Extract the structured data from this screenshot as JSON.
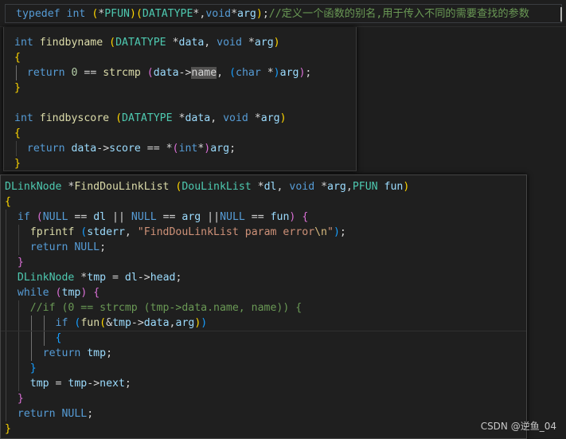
{
  "editor": {
    "top_line": [
      {
        "c": "kw",
        "t": "typedef"
      },
      {
        "c": "txt",
        "t": " "
      },
      {
        "c": "kw",
        "t": "int"
      },
      {
        "c": "txt",
        "t": " "
      },
      {
        "c": "br1",
        "t": "("
      },
      {
        "c": "txt",
        "t": "*"
      },
      {
        "c": "ty",
        "t": "PFUN"
      },
      {
        "c": "br1",
        "t": ")"
      },
      {
        "c": "br1",
        "t": "("
      },
      {
        "c": "ty",
        "t": "DATATYPE"
      },
      {
        "c": "txt",
        "t": "*,"
      },
      {
        "c": "kw",
        "t": "void"
      },
      {
        "c": "txt",
        "t": "*"
      },
      {
        "c": "var",
        "t": "arg"
      },
      {
        "c": "br1",
        "t": ")"
      },
      {
        "c": "txt",
        "t": ";"
      },
      {
        "c": "cmt",
        "t": "//定义一个函数的别名,用于传入不同的需要查找的参数"
      }
    ],
    "snippet_findbyname_score": [
      [
        {
          "c": "kw",
          "t": "int"
        },
        {
          "c": "txt",
          "t": " "
        },
        {
          "c": "fn",
          "t": "findbyname"
        },
        {
          "c": "txt",
          "t": " "
        },
        {
          "c": "br1",
          "t": "("
        },
        {
          "c": "ty",
          "t": "DATATYPE"
        },
        {
          "c": "txt",
          "t": " *"
        },
        {
          "c": "var",
          "t": "data"
        },
        {
          "c": "txt",
          "t": ", "
        },
        {
          "c": "kw",
          "t": "void"
        },
        {
          "c": "txt",
          "t": " *"
        },
        {
          "c": "var",
          "t": "arg"
        },
        {
          "c": "br1",
          "t": ")"
        }
      ],
      [
        {
          "c": "br1",
          "t": "{"
        }
      ],
      [
        {
          "c": "txt",
          "t": "  "
        },
        {
          "c": "kw",
          "t": "return"
        },
        {
          "c": "txt",
          "t": " "
        },
        {
          "c": "num",
          "t": "0"
        },
        {
          "c": "txt",
          "t": " == "
        },
        {
          "c": "fn",
          "t": "strcmp"
        },
        {
          "c": "txt",
          "t": " "
        },
        {
          "c": "br2",
          "t": "("
        },
        {
          "c": "var",
          "t": "data"
        },
        {
          "c": "txt",
          "t": "->"
        },
        {
          "c": "hl",
          "t": "name"
        },
        {
          "c": "txt",
          "t": ", "
        },
        {
          "c": "br3",
          "t": "("
        },
        {
          "c": "kw",
          "t": "char"
        },
        {
          "c": "txt",
          "t": " *"
        },
        {
          "c": "br3",
          "t": ")"
        },
        {
          "c": "var",
          "t": "arg"
        },
        {
          "c": "br2",
          "t": ")"
        },
        {
          "c": "txt",
          "t": ";"
        }
      ],
      [
        {
          "c": "br1",
          "t": "}"
        }
      ],
      [],
      [
        {
          "c": "kw",
          "t": "int"
        },
        {
          "c": "txt",
          "t": " "
        },
        {
          "c": "fn",
          "t": "findbyscore"
        },
        {
          "c": "txt",
          "t": " "
        },
        {
          "c": "br1",
          "t": "("
        },
        {
          "c": "ty",
          "t": "DATATYPE"
        },
        {
          "c": "txt",
          "t": " *"
        },
        {
          "c": "var",
          "t": "data"
        },
        {
          "c": "txt",
          "t": ", "
        },
        {
          "c": "kw",
          "t": "void"
        },
        {
          "c": "txt",
          "t": " *"
        },
        {
          "c": "var",
          "t": "arg"
        },
        {
          "c": "br1",
          "t": ")"
        }
      ],
      [
        {
          "c": "br1",
          "t": "{"
        }
      ],
      [
        {
          "c": "txt",
          "t": "  "
        },
        {
          "c": "kw",
          "t": "return"
        },
        {
          "c": "txt",
          "t": " "
        },
        {
          "c": "var",
          "t": "data"
        },
        {
          "c": "txt",
          "t": "->"
        },
        {
          "c": "var",
          "t": "score"
        },
        {
          "c": "txt",
          "t": " == *"
        },
        {
          "c": "br2",
          "t": "("
        },
        {
          "c": "kw",
          "t": "int"
        },
        {
          "c": "txt",
          "t": "*"
        },
        {
          "c": "br2",
          "t": ")"
        },
        {
          "c": "var",
          "t": "arg"
        },
        {
          "c": "txt",
          "t": ";"
        }
      ],
      [
        {
          "c": "br1",
          "t": "}"
        }
      ]
    ],
    "snippet_find_dou_link_list": [
      [
        {
          "c": "ty",
          "t": "DLinkNode"
        },
        {
          "c": "txt",
          "t": " *"
        },
        {
          "c": "fn",
          "t": "FindDouLinkList"
        },
        {
          "c": "txt",
          "t": " "
        },
        {
          "c": "br1",
          "t": "("
        },
        {
          "c": "ty",
          "t": "DouLinkList"
        },
        {
          "c": "txt",
          "t": " *"
        },
        {
          "c": "var",
          "t": "dl"
        },
        {
          "c": "txt",
          "t": ", "
        },
        {
          "c": "kw",
          "t": "void"
        },
        {
          "c": "txt",
          "t": " *"
        },
        {
          "c": "var",
          "t": "arg"
        },
        {
          "c": "txt",
          "t": ","
        },
        {
          "c": "ty",
          "t": "PFUN"
        },
        {
          "c": "txt",
          "t": " "
        },
        {
          "c": "var",
          "t": "fun"
        },
        {
          "c": "br1",
          "t": ")"
        }
      ],
      [
        {
          "c": "br1",
          "t": "{"
        }
      ],
      [
        {
          "c": "txt",
          "t": "  "
        },
        {
          "c": "kw",
          "t": "if"
        },
        {
          "c": "txt",
          "t": " "
        },
        {
          "c": "br2",
          "t": "("
        },
        {
          "c": "kw",
          "t": "NULL"
        },
        {
          "c": "txt",
          "t": " == "
        },
        {
          "c": "var",
          "t": "dl"
        },
        {
          "c": "txt",
          "t": " || "
        },
        {
          "c": "kw",
          "t": "NULL"
        },
        {
          "c": "txt",
          "t": " == "
        },
        {
          "c": "var",
          "t": "arg"
        },
        {
          "c": "txt",
          "t": " ||"
        },
        {
          "c": "kw",
          "t": "NULL"
        },
        {
          "c": "txt",
          "t": " == "
        },
        {
          "c": "var",
          "t": "fun"
        },
        {
          "c": "br2",
          "t": ")"
        },
        {
          "c": "txt",
          "t": " "
        },
        {
          "c": "br2",
          "t": "{"
        }
      ],
      [
        {
          "c": "txt",
          "t": "    "
        },
        {
          "c": "fn",
          "t": "fprintf"
        },
        {
          "c": "txt",
          "t": " "
        },
        {
          "c": "br3",
          "t": "("
        },
        {
          "c": "var",
          "t": "stderr"
        },
        {
          "c": "txt",
          "t": ", "
        },
        {
          "c": "str",
          "t": "\"FindDouLinkList param error"
        },
        {
          "c": "esc",
          "t": "\\n"
        },
        {
          "c": "str",
          "t": "\""
        },
        {
          "c": "br3",
          "t": ")"
        },
        {
          "c": "txt",
          "t": ";"
        }
      ],
      [
        {
          "c": "txt",
          "t": "    "
        },
        {
          "c": "kw",
          "t": "return"
        },
        {
          "c": "txt",
          "t": " "
        },
        {
          "c": "kw",
          "t": "NULL"
        },
        {
          "c": "txt",
          "t": ";"
        }
      ],
      [
        {
          "c": "txt",
          "t": "  "
        },
        {
          "c": "br2",
          "t": "}"
        }
      ],
      [
        {
          "c": "txt",
          "t": "  "
        },
        {
          "c": "ty",
          "t": "DLinkNode"
        },
        {
          "c": "txt",
          "t": " *"
        },
        {
          "c": "var",
          "t": "tmp"
        },
        {
          "c": "txt",
          "t": " = "
        },
        {
          "c": "var",
          "t": "dl"
        },
        {
          "c": "txt",
          "t": "->"
        },
        {
          "c": "var",
          "t": "head"
        },
        {
          "c": "txt",
          "t": ";"
        }
      ],
      [
        {
          "c": "txt",
          "t": "  "
        },
        {
          "c": "kw",
          "t": "while"
        },
        {
          "c": "txt",
          "t": " "
        },
        {
          "c": "br2",
          "t": "("
        },
        {
          "c": "var",
          "t": "tmp"
        },
        {
          "c": "br2",
          "t": ")"
        },
        {
          "c": "txt",
          "t": " "
        },
        {
          "c": "br2",
          "t": "{"
        }
      ],
      [
        {
          "c": "txt",
          "t": "    "
        },
        {
          "c": "cmt",
          "t": "//if (0 == strcmp (tmp->data.name, name)) {"
        }
      ],
      [
        {
          "c": "txt",
          "t": "        "
        },
        {
          "c": "kw",
          "t": "if"
        },
        {
          "c": "txt",
          "t": " "
        },
        {
          "c": "br3",
          "t": "("
        },
        {
          "c": "fn",
          "t": "fun"
        },
        {
          "c": "br1",
          "t": "("
        },
        {
          "c": "txt",
          "t": "&"
        },
        {
          "c": "var",
          "t": "tmp"
        },
        {
          "c": "txt",
          "t": "->"
        },
        {
          "c": "var",
          "t": "data"
        },
        {
          "c": "txt",
          "t": ","
        },
        {
          "c": "var",
          "t": "arg"
        },
        {
          "c": "br1",
          "t": ")"
        },
        {
          "c": "br3",
          "t": ")"
        }
      ],
      [
        {
          "c": "txt",
          "t": "        "
        },
        {
          "c": "br3",
          "t": "{"
        }
      ],
      [
        {
          "c": "txt",
          "t": "      "
        },
        {
          "c": "kw",
          "t": "return"
        },
        {
          "c": "txt",
          "t": " "
        },
        {
          "c": "var",
          "t": "tmp"
        },
        {
          "c": "txt",
          "t": ";"
        }
      ],
      [
        {
          "c": "txt",
          "t": "    "
        },
        {
          "c": "br3",
          "t": "}"
        }
      ],
      [
        {
          "c": "txt",
          "t": "    "
        },
        {
          "c": "var",
          "t": "tmp"
        },
        {
          "c": "txt",
          "t": " = "
        },
        {
          "c": "var",
          "t": "tmp"
        },
        {
          "c": "txt",
          "t": "->"
        },
        {
          "c": "var",
          "t": "next"
        },
        {
          "c": "txt",
          "t": ";"
        }
      ],
      [
        {
          "c": "txt",
          "t": "  "
        },
        {
          "c": "br2",
          "t": "}"
        }
      ],
      [
        {
          "c": "txt",
          "t": "  "
        },
        {
          "c": "kw",
          "t": "return"
        },
        {
          "c": "txt",
          "t": " "
        },
        {
          "c": "kw",
          "t": "NULL"
        },
        {
          "c": "txt",
          "t": ";"
        }
      ],
      [
        {
          "c": "br1",
          "t": "}"
        }
      ]
    ]
  },
  "watermark": "CSDN @逆鱼_04",
  "theme": {
    "background": "#1e1e1e",
    "keyword": "#569cd6",
    "type": "#4ec9b0",
    "function": "#dcdcaa",
    "variable": "#9cdcfe",
    "string": "#ce9178",
    "comment": "#6a9955"
  }
}
